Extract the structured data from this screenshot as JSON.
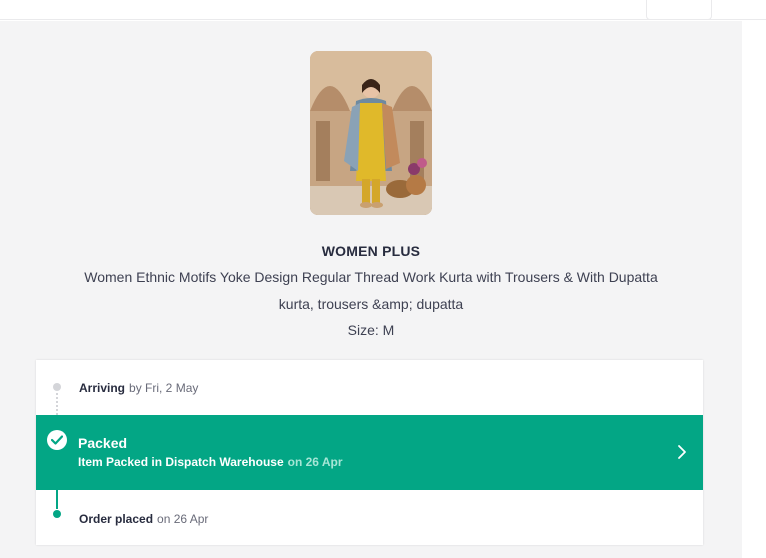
{
  "product": {
    "image_alt": "Woman in yellow kurta with printed dupatta",
    "brand": "WOMEN PLUS",
    "name": "Women Ethnic Motifs Yoke Design Regular Thread Work Kurta with Trousers & With Dupatta",
    "subtitle": "kurta, trousers &amp; dupatta",
    "size": "Size: M"
  },
  "tracking": {
    "arriving": {
      "label": "Arriving",
      "detail": "by Fri, 2 May"
    },
    "packed": {
      "title": "Packed",
      "description": "Item Packed in Dispatch Warehouse",
      "date": "on 26 Apr"
    },
    "order_placed": {
      "label": "Order placed",
      "detail": "on 26 Apr"
    }
  },
  "colors": {
    "accent": "#03a685",
    "background": "#f4f4f5",
    "text": "#282c3f",
    "muted_text": "#696b79"
  },
  "icons": {
    "packed": "check-circle-icon",
    "navigate": "chevron-right-icon"
  }
}
